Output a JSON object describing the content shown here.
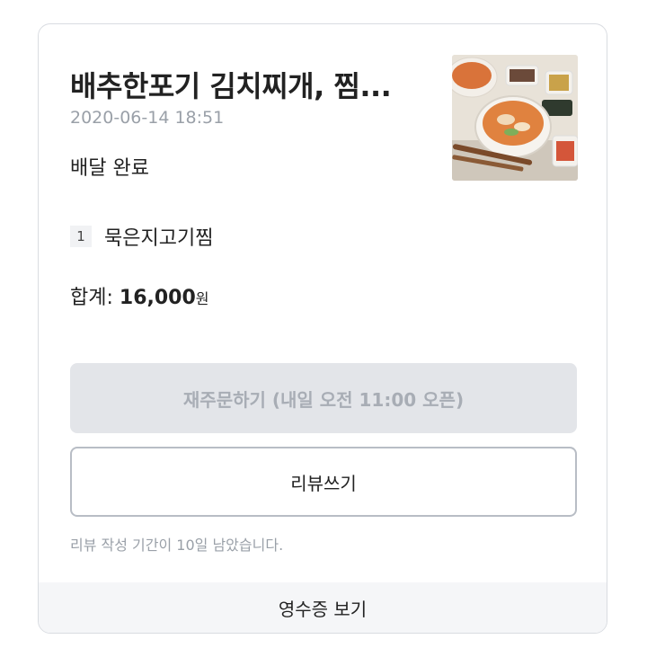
{
  "order": {
    "restaurant_title": "배추한포기 김치찌개, 찜...",
    "datetime": "2020-06-14 18:51",
    "status": "배달 완료",
    "items": [
      {
        "qty": "1",
        "name": "묵은지고기찜"
      }
    ],
    "total_label": "합계: ",
    "total_amount": "16,000",
    "total_unit": "원"
  },
  "actions": {
    "reorder_label": "재주문하기 (내일 오전 11:00 오픈)",
    "review_label": "리뷰쓰기",
    "review_notice": "리뷰 작성 기간이 10일 남았습니다.",
    "receipt_label": "영수증 보기"
  },
  "colors": {
    "disabled_button_bg": "#e3e5e9",
    "disabled_button_text": "#a8adb5",
    "muted_text": "#9aa0a8",
    "footer_bg": "#f5f6f8"
  }
}
